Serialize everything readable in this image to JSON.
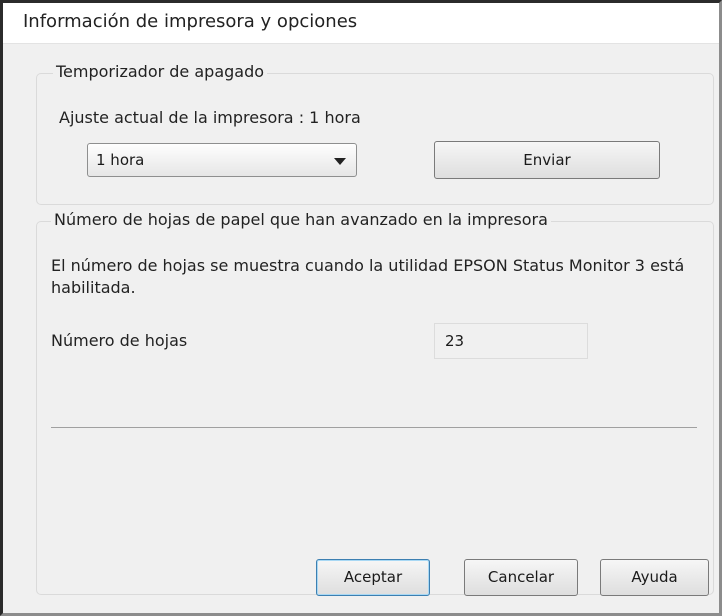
{
  "window": {
    "title": "Información de impresora y opciones"
  },
  "power_off": {
    "group_label": "Temporizador de apagado",
    "current_setting": "Ajuste actual de la impresora : 1 hora",
    "selected_value": "1 hora",
    "send_label": "Enviar"
  },
  "sheets": {
    "group_label": "Número de hojas de papel que han avanzado en la impresora",
    "description": "El número de hojas se muestra cuando la utilidad EPSON Status Monitor 3 está habilitada.",
    "count_label": "Número de hojas",
    "count_value": "23"
  },
  "footer": {
    "ok_label": "Aceptar",
    "cancel_label": "Cancelar",
    "help_label": "Ayuda"
  }
}
